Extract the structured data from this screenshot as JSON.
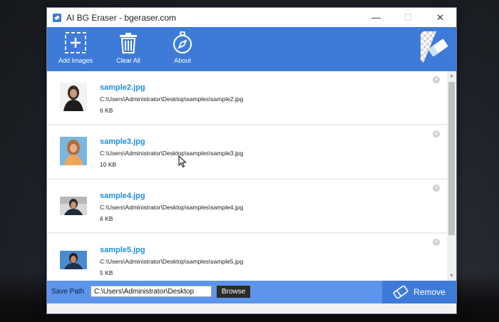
{
  "window": {
    "title": "AI BG Eraser - bgeraser.com",
    "controls": {
      "minimize": "—",
      "maximize": "☐",
      "close": "✕"
    }
  },
  "toolbar": {
    "add_images": "Add Images",
    "clear_all": "Clear All",
    "about": "About"
  },
  "files": [
    {
      "name": "sample2.jpg",
      "path": "C:\\Users\\Administrator\\Desktop\\samples\\sample2.jpg",
      "size": "6 KB"
    },
    {
      "name": "sample3.jpg",
      "path": "C:\\Users\\Administrator\\Desktop\\samples\\sample3.jpg",
      "size": "10 KB"
    },
    {
      "name": "sample4.jpg",
      "path": "C:\\Users\\Administrator\\Desktop\\samples\\sample4.jpg",
      "size": "6 KB"
    },
    {
      "name": "sample5.jpg",
      "path": "C:\\Users\\Administrator\\Desktop\\samples\\sample5.jpg",
      "size": "5 KB"
    }
  ],
  "bottom": {
    "save_path_label": "Save Path",
    "save_path_value": "C:\\Users\\Administrator\\Desktop",
    "browse": "Browse",
    "remove": "Remove"
  },
  "colors": {
    "accent": "#3e7bd9",
    "bottom_bar": "#5d95ec",
    "file_name": "#1e8fe0"
  }
}
